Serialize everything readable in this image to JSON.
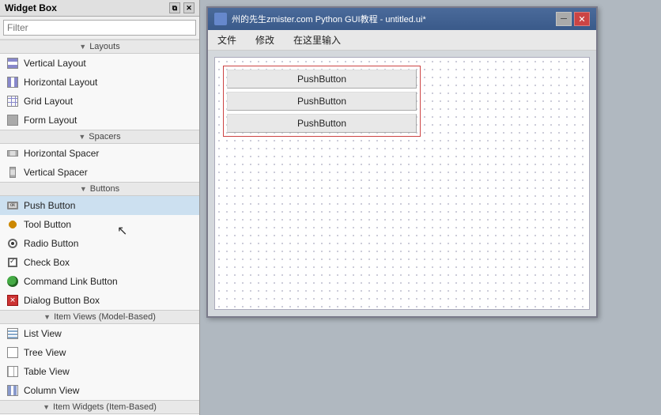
{
  "widget_box": {
    "title": "Widget Box",
    "filter_placeholder": "Filter",
    "sections": [
      {
        "name": "layouts",
        "label": "Layouts",
        "items": [
          {
            "id": "vertical-layout",
            "label": "Vertical Layout",
            "icon": "layout-v"
          },
          {
            "id": "horizontal-layout",
            "label": "Horizontal Layout",
            "icon": "layout-h"
          },
          {
            "id": "grid-layout",
            "label": "Grid Layout",
            "icon": "grid"
          },
          {
            "id": "form-layout",
            "label": "Form Layout",
            "icon": "form"
          }
        ]
      },
      {
        "name": "spacers",
        "label": "Spacers",
        "items": [
          {
            "id": "horizontal-spacer",
            "label": "Horizontal Spacer",
            "icon": "hspacer"
          },
          {
            "id": "vertical-spacer",
            "label": "Vertical Spacer",
            "icon": "vspacer"
          }
        ]
      },
      {
        "name": "buttons",
        "label": "Buttons",
        "items": [
          {
            "id": "push-button",
            "label": "Push Button",
            "icon": "pushbtn"
          },
          {
            "id": "tool-button",
            "label": "Tool Button",
            "icon": "toolbtn"
          },
          {
            "id": "radio-button",
            "label": "Radio Button",
            "icon": "radio"
          },
          {
            "id": "check-box",
            "label": "Check Box",
            "icon": "check"
          },
          {
            "id": "command-link-button",
            "label": "Command Link Button",
            "icon": "cmdlink"
          },
          {
            "id": "dialog-button-box",
            "label": "Dialog Button Box",
            "icon": "dialog"
          }
        ]
      },
      {
        "name": "item-views",
        "label": "Item Views (Model-Based)",
        "items": [
          {
            "id": "list-view",
            "label": "List View",
            "icon": "listview"
          },
          {
            "id": "tree-view",
            "label": "Tree View",
            "icon": "treeview"
          },
          {
            "id": "table-view",
            "label": "Table View",
            "icon": "tableview"
          },
          {
            "id": "column-view",
            "label": "Column View",
            "icon": "columnview"
          }
        ]
      },
      {
        "name": "item-widgets",
        "label": "Item Widgets (Item-Based)",
        "items": []
      }
    ]
  },
  "qt_window": {
    "title": "州的先生zmister.com Python GUI教程 - untitled.ui*",
    "icon_label": "Qt",
    "menu_items": [
      "文件",
      "修改",
      "在这里输入"
    ],
    "buttons": [
      {
        "label": "PushButton"
      },
      {
        "label": "PushButton"
      },
      {
        "label": "PushButton"
      }
    ],
    "min_btn": "─",
    "close_btn": "✕"
  }
}
